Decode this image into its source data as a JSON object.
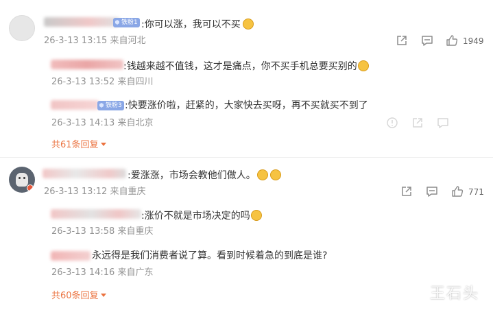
{
  "comments": [
    {
      "badge": "铁粉1",
      "text": ":你可以涨，我可以不买",
      "meta": "26-3-13 13:15 来自河北",
      "likes": "1949",
      "replies": [
        {
          "text": ":钱越来越不值钱，这才是痛点，你不买手机总要买别的",
          "meta": "26-3-13 13:52 来自四川"
        },
        {
          "badge": "铁粉3",
          "text": ":快要涨价啦，赶紧的，大家快去买呀，再不买就买不到了",
          "meta": "26-3-13 14:13 来自北京"
        }
      ],
      "more": "共61条回复"
    },
    {
      "text": ":爱涨涨，市场会教他们做人。",
      "meta": "26-3-13 13:12 来自重庆",
      "likes": "771",
      "replies": [
        {
          "text": ":涨价不就是市场决定的吗",
          "meta": "26-3-13 13:58 来自重庆"
        },
        {
          "text": "永远得是我们消费者说了算。看到时候着急的到底是谁?",
          "meta": "26-3-13 14:16 来自广东"
        }
      ],
      "more": "共60条回复"
    }
  ],
  "watermark": "王石头",
  "icons": {
    "share": "share-icon",
    "comment": "comment-icon",
    "like": "thumbs-up-icon"
  }
}
